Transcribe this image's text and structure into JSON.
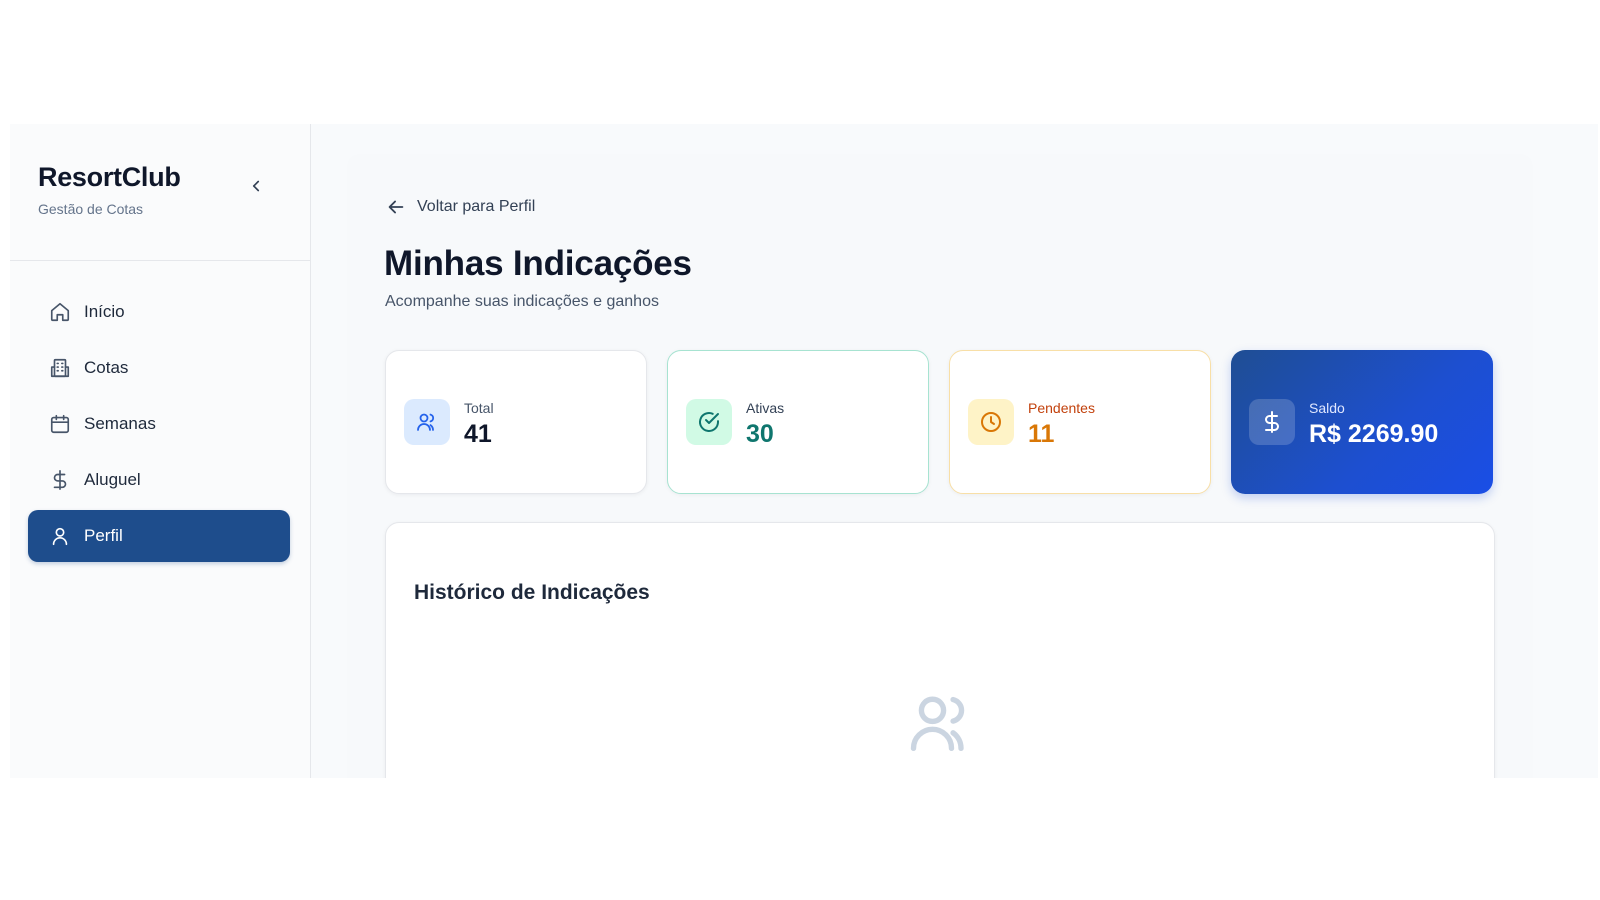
{
  "brand": {
    "title": "ResortClub",
    "subtitle": "Gestão de Cotas"
  },
  "sidebar": {
    "collapse_icon": "chevron-left-icon",
    "items": [
      {
        "label": "Início",
        "icon": "home-icon",
        "active": false
      },
      {
        "label": "Cotas",
        "icon": "building-icon",
        "active": false
      },
      {
        "label": "Semanas",
        "icon": "calendar-icon",
        "active": false
      },
      {
        "label": "Aluguel",
        "icon": "dollar-icon",
        "active": false
      },
      {
        "label": "Perfil",
        "icon": "user-icon",
        "active": true
      }
    ]
  },
  "page": {
    "back_label": "Voltar para Perfil",
    "title": "Minhas Indicações",
    "subtitle": "Acompanhe suas indicações e ganhos"
  },
  "stats": {
    "total": {
      "label": "Total",
      "value": "41",
      "icon": "users-icon"
    },
    "ativas": {
      "label": "Ativas",
      "value": "30",
      "icon": "check-circle-icon"
    },
    "pendentes": {
      "label": "Pendentes",
      "value": "11",
      "icon": "clock-icon"
    },
    "saldo": {
      "label": "Saldo",
      "value": "R$ 2269.90",
      "icon": "dollar-icon"
    }
  },
  "history": {
    "title": "Histórico de Indicações",
    "empty_icon": "users-icon"
  },
  "colors": {
    "accent": "#1e4d8c",
    "saldo_gradient_start": "#1f4e93",
    "saldo_gradient_end": "#1a4ee6",
    "ativas": "#0f766e",
    "pendentes": "#d97706"
  }
}
